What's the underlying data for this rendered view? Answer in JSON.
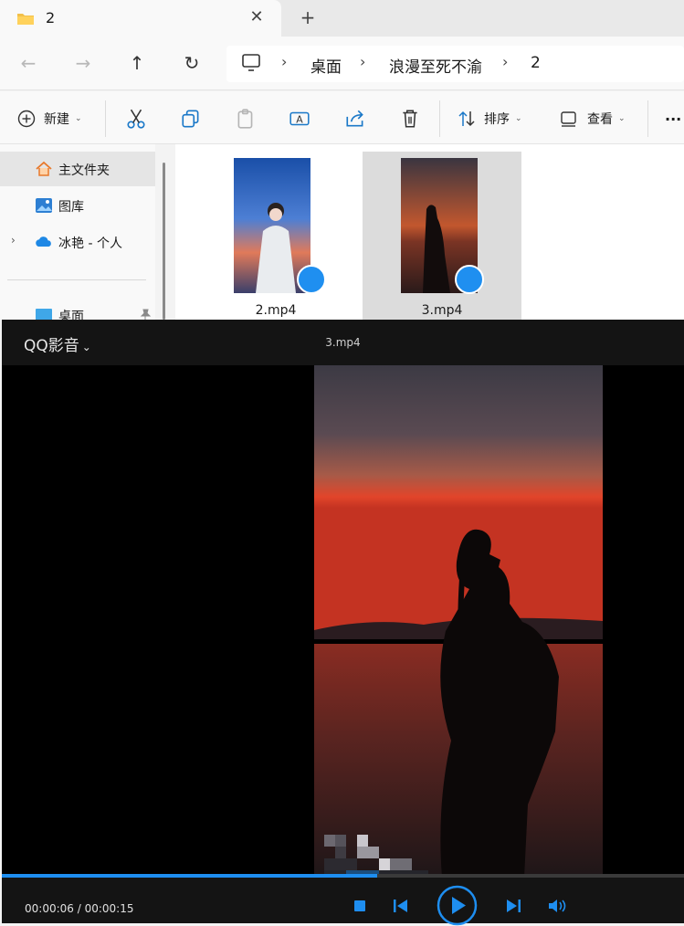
{
  "tab": {
    "title": "2",
    "close": "✕",
    "new_tab": "+"
  },
  "nav": {
    "back": "←",
    "forward": "→",
    "up": "↑",
    "refresh": "↻"
  },
  "breadcrumb": {
    "items": [
      "桌面",
      "浪漫至死不渝",
      "2"
    ],
    "separator": "›"
  },
  "toolbar": {
    "new_label": "新建",
    "sort_label": "排序",
    "view_label": "查看",
    "more_label": "···",
    "chevron": "⌄"
  },
  "sidebar": {
    "items": [
      {
        "label": "主文件夹",
        "icon": "home-icon"
      },
      {
        "label": "图库",
        "icon": "gallery-icon"
      },
      {
        "label": "冰艳 - 个人",
        "icon": "onedrive-cloud-icon",
        "expander": "›"
      },
      {
        "label": "桌面",
        "icon": "desktop-icon"
      }
    ]
  },
  "files": [
    {
      "name": "2.mp4",
      "selected": false
    },
    {
      "name": "3.mp4",
      "selected": true
    }
  ],
  "player": {
    "brand": "QQ影音",
    "brand_chevron": "⌄",
    "title": "3.mp4",
    "current_time": "00:00:06",
    "total_time": "00:00:15",
    "time_separator": " / ",
    "progress_fraction": 0.55,
    "accent_color": "#1e8ef0"
  }
}
